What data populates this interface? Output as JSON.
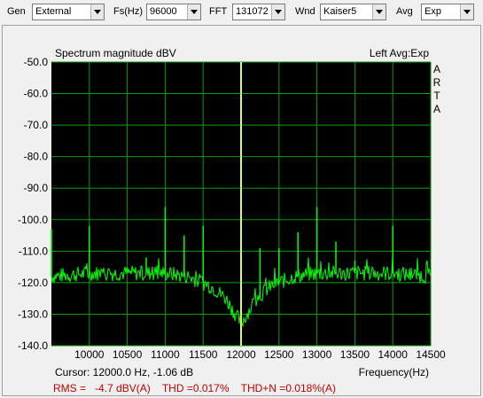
{
  "toolbar": {
    "gen_label": "Gen",
    "gen_value": "External",
    "fs_label": "Fs(Hz)",
    "fs_value": "96000",
    "fft_label": "FFT",
    "fft_value": "131072",
    "wnd_label": "Wnd",
    "wnd_value": "Kaiser5",
    "avg_label": "Avg",
    "avg_value": "Exp"
  },
  "plot": {
    "title": "Spectrum magnitude dBV",
    "channel": "Left  Avg:Exp",
    "brand_letters": [
      "A",
      "R",
      "T",
      "A"
    ],
    "cursor": "Cursor: 12000.0 Hz, -1.06 dB",
    "status": "RMS =   -4.7 dBV(A)    THD =0.017%    THD+N =0.018%(A)",
    "background_color": "#000000",
    "grid_color": "#00a000",
    "trace_color": "#00ff00",
    "fundamental_color": "#e8ff40",
    "status_color": "#c00000"
  },
  "chart_data": {
    "type": "line",
    "title": "Spectrum magnitude dBV",
    "xlabel": "Frequency(Hz)",
    "ylabel": "",
    "xlim": [
      9500,
      14500
    ],
    "ylim": [
      -140,
      -50
    ],
    "x_ticks": [
      10000,
      10500,
      11000,
      11500,
      12000,
      12500,
      13000,
      13500,
      14000,
      14500
    ],
    "y_ticks": [
      "-50.0",
      "-60.0",
      "-70.0",
      "-80.0",
      "-90.0",
      "-100.0",
      "-110.0",
      "-120.0",
      "-130.0",
      "-140.0"
    ],
    "grid": true,
    "noise_floor": [
      [
        9500,
        -118
      ],
      [
        10000,
        -117
      ],
      [
        10500,
        -117
      ],
      [
        11000,
        -117
      ],
      [
        11300,
        -118
      ],
      [
        11600,
        -121
      ],
      [
        11800,
        -125
      ],
      [
        11950,
        -131
      ],
      [
        12000,
        -133
      ],
      [
        12050,
        -131
      ],
      [
        12200,
        -125
      ],
      [
        12400,
        -121
      ],
      [
        12700,
        -118
      ],
      [
        13000,
        -117
      ],
      [
        13500,
        -117
      ],
      [
        14000,
        -117
      ],
      [
        14500,
        -118
      ]
    ],
    "peaks": [
      {
        "x": 9500,
        "y": -103
      },
      {
        "x": 10000,
        "y": -102
      },
      {
        "x": 10750,
        "y": -112
      },
      {
        "x": 11000,
        "y": -96
      },
      {
        "x": 11250,
        "y": -105
      },
      {
        "x": 11500,
        "y": -102
      },
      {
        "x": 12000,
        "y": -51
      },
      {
        "x": 12250,
        "y": -109
      },
      {
        "x": 12500,
        "y": -109
      },
      {
        "x": 12750,
        "y": -104
      },
      {
        "x": 13000,
        "y": -96
      },
      {
        "x": 13250,
        "y": -107
      },
      {
        "x": 13500,
        "y": -113
      },
      {
        "x": 14000,
        "y": -102
      }
    ],
    "fundamental": {
      "x": 12000,
      "y": -50
    }
  }
}
